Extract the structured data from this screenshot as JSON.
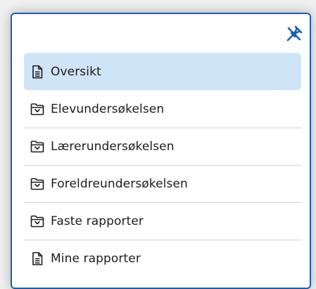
{
  "panel": {
    "pin_icon": "unpin-icon",
    "accent_color": "#1f5fa8",
    "active_background": "#cfe4f7"
  },
  "menu": {
    "items": [
      {
        "label": "Oversikt",
        "icon": "document-icon",
        "active": true
      },
      {
        "label": "Elevundersøkelsen",
        "icon": "folder-icon",
        "active": false
      },
      {
        "label": "Lærerundersøkelsen",
        "icon": "folder-icon",
        "active": false
      },
      {
        "label": "Foreldreundersøkelsen",
        "icon": "folder-icon",
        "active": false
      },
      {
        "label": "Faste rapporter",
        "icon": "folder-icon",
        "active": false
      },
      {
        "label": "Mine rapporter",
        "icon": "document-icon",
        "active": false
      }
    ]
  }
}
